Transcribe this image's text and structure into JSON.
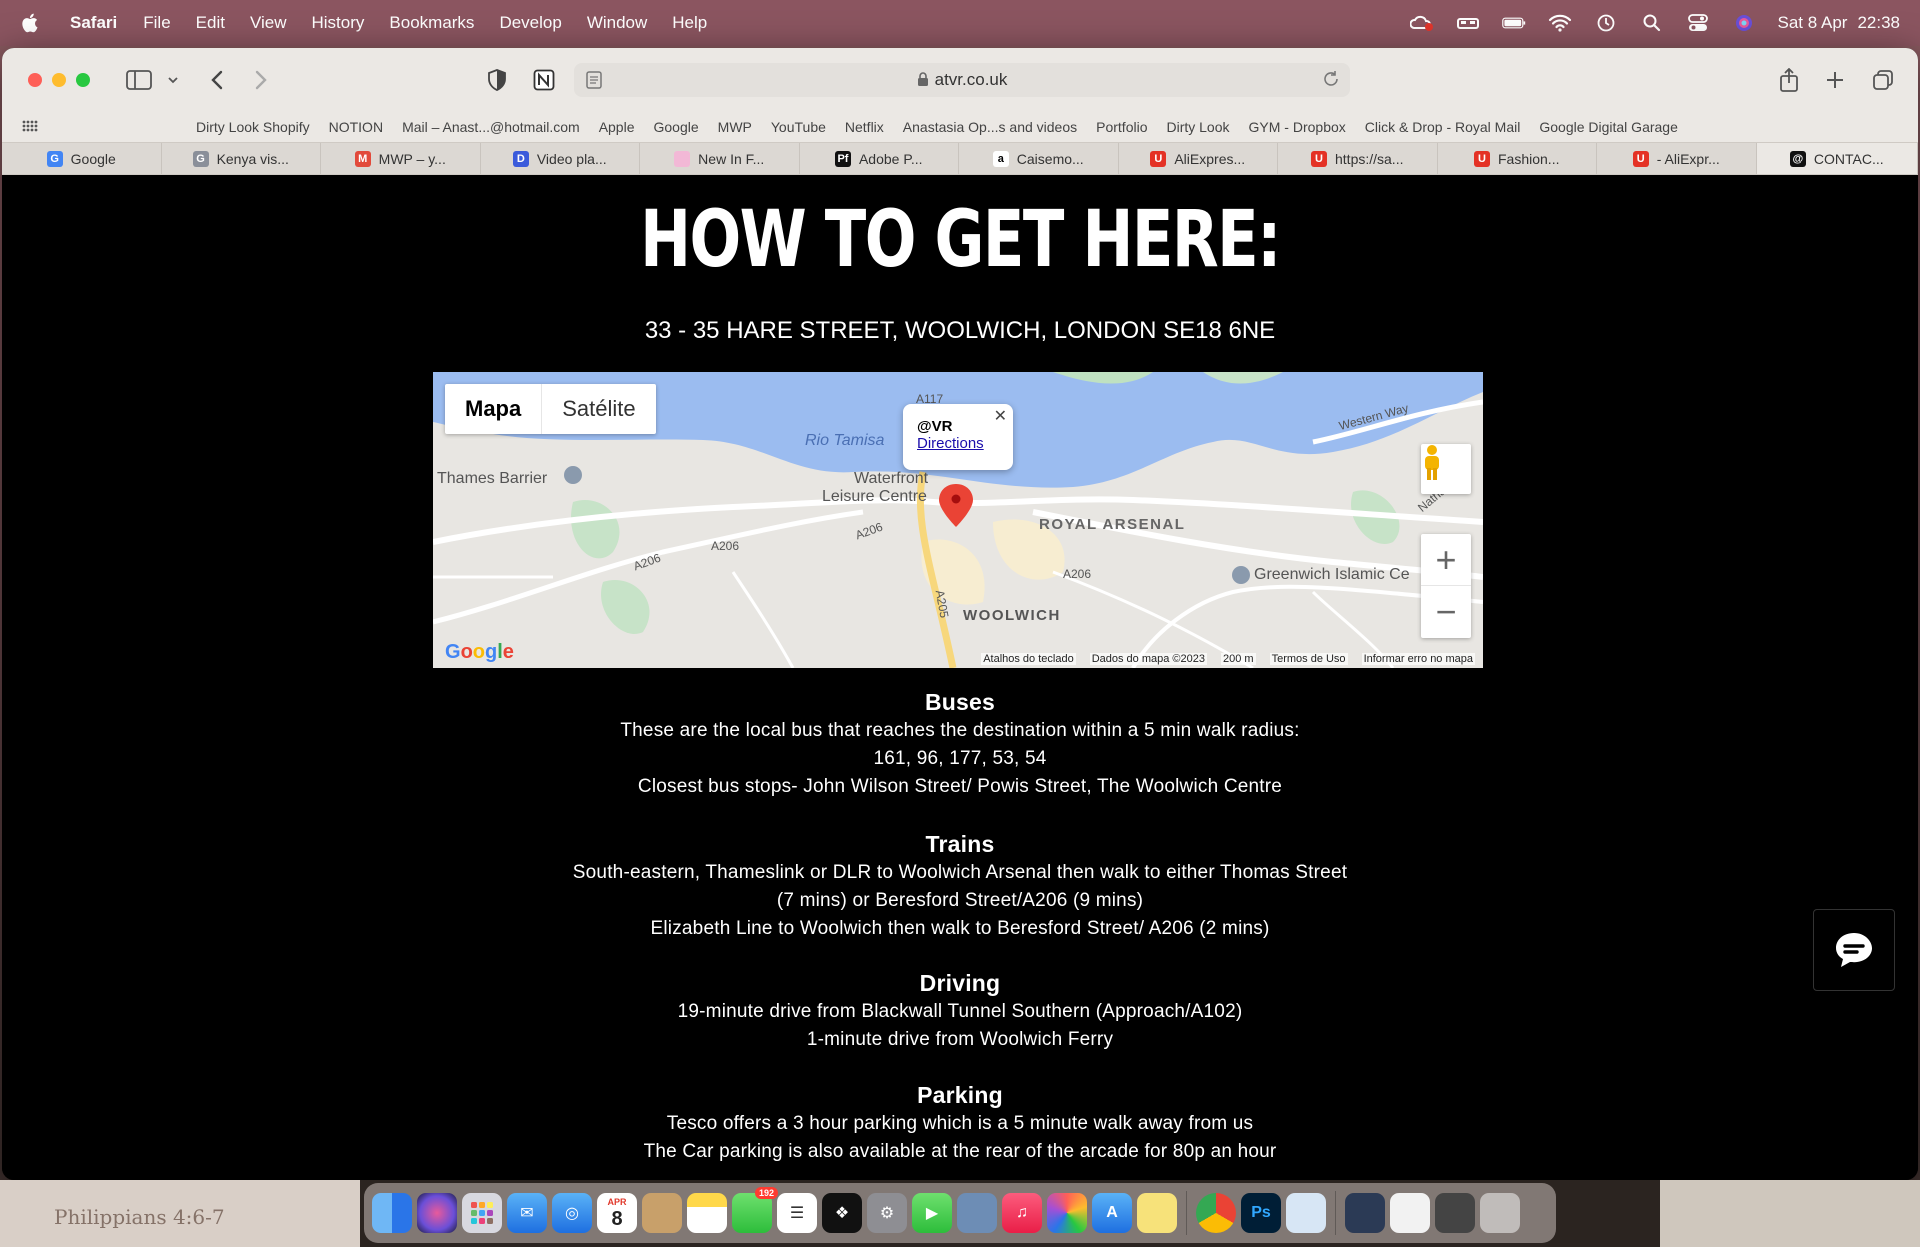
{
  "menubar": {
    "app_name": "Safari",
    "items": [
      "File",
      "Edit",
      "View",
      "History",
      "Bookmarks",
      "Develop",
      "Window",
      "Help"
    ],
    "date": "Sat 8 Apr",
    "time": "22:38"
  },
  "browser": {
    "url": "atvr.co.uk",
    "favorites": [
      "Dirty Look Shopify",
      "NOTION",
      "Mail – Anast...@hotmail.com",
      "Apple",
      "Google",
      "MWP",
      "YouTube",
      "Netflix",
      "Anastasia Op...s and videos",
      "Portfolio",
      "Dirty Look",
      "GYM - Dropbox",
      "Click & Drop - Royal Mail",
      "Google Digital Garage"
    ],
    "tabs": [
      {
        "label": "Google",
        "color": "#4285f4",
        "glyph": "G"
      },
      {
        "label": "Kenya vis...",
        "color": "#8a8f99",
        "glyph": "G"
      },
      {
        "label": "MWP – y...",
        "color": "#e24a3b",
        "glyph": "M"
      },
      {
        "label": "Video pla...",
        "color": "#3b5bdb",
        "glyph": "D"
      },
      {
        "label": "New In F...",
        "color": "#f2b8d6",
        "glyph": ""
      },
      {
        "label": "Adobe P...",
        "color": "#111111",
        "glyph": "Pf"
      },
      {
        "label": "Caisemo...",
        "color": "#ffffff",
        "glyph": "a"
      },
      {
        "label": "AliExpres...",
        "color": "#e43225",
        "glyph": "U"
      },
      {
        "label": "https://sa...",
        "color": "#e43225",
        "glyph": "U"
      },
      {
        "label": "Fashion...",
        "color": "#e43225",
        "glyph": "U"
      },
      {
        "label": "- AliExpr...",
        "color": "#e43225",
        "glyph": "U"
      },
      {
        "label": "CONTAC...",
        "color": "#111111",
        "glyph": "@"
      }
    ]
  },
  "page": {
    "title": "HOW TO GET HERE:",
    "address": "33 - 35 HARE STREET, WOOLWICH, LONDON  SE18 6NE",
    "map": {
      "type_buttons": [
        "Mapa",
        "Satélite"
      ],
      "info_title": "@VR",
      "info_link": "Directions",
      "labels": {
        "river": "Rio Tamisa",
        "thames_barrier": "Thames Barrier",
        "waterfront": "Waterfront",
        "leisure": "Leisure Centre",
        "royal_arsenal": "ROYAL ARSENAL",
        "woolwich": "WOOLWICH",
        "islamic": "Greenwich Islamic Ce",
        "western_way": "Western Way",
        "a117": "A117",
        "a206_1": "A206",
        "a206_2": "A206",
        "a206_3": "A206",
        "a206_4": "A206",
        "a205": "A205",
        "nathan": "Nathan"
      },
      "footer": [
        "Atalhos do teclado",
        "Dados do mapa ©2023",
        "200 m",
        "Termos de Uso",
        "Informar erro no mapa"
      ],
      "logo": "Google"
    },
    "sections": [
      {
        "heading": "Buses",
        "lines": [
          "These are the local bus that reaches the destination within a 5 min walk radius:",
          "161, 96, 177, 53, 54",
          "Closest bus stops- John Wilson Street/ Powis Street, The Woolwich Centre"
        ]
      },
      {
        "heading": "Trains",
        "lines": [
          "South-eastern, Thameslink or DLR to Woolwich Arsenal then walk to either Thomas Street",
          "(7 mins) or Beresford Street/A206 (9 mins)",
          "Elizabeth Line to Woolwich then walk to Beresford Street/ A206 (2 mins)"
        ]
      },
      {
        "heading": "Driving",
        "lines": [
          "19-minute drive from Blackwall Tunnel Southern (Approach/A102)",
          "1-minute drive from Woolwich Ferry"
        ]
      },
      {
        "heading": "Parking",
        "lines": [
          "Tesco offers a 3 hour parking which is a 5 minute walk away from us",
          "The Car parking is also available at the rear of the arcade for 80p an hour"
        ]
      }
    ]
  },
  "desktop": {
    "note": "Philippians 4:6-7",
    "calendar_month": "APR",
    "calendar_day": "8",
    "messages_badge": "192"
  }
}
